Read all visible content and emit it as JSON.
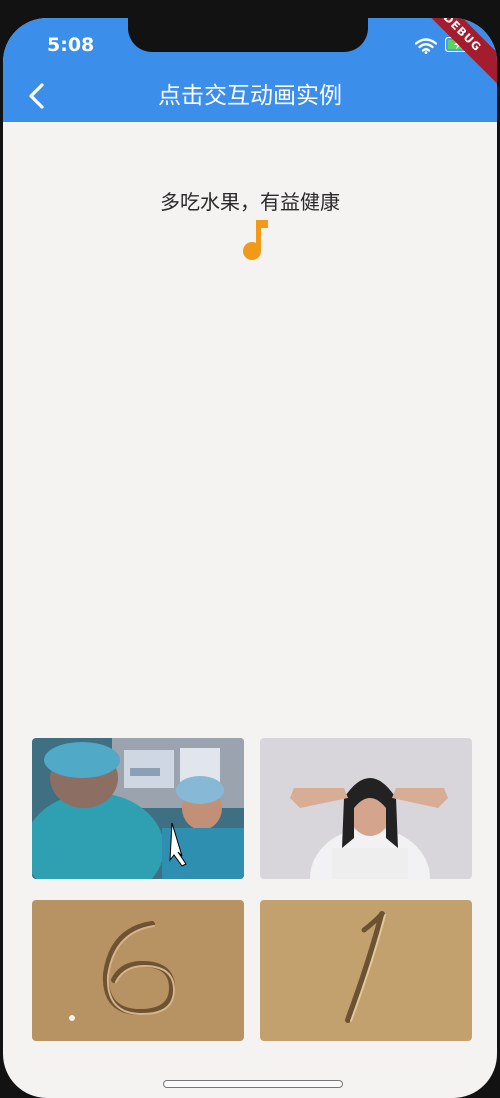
{
  "status_bar": {
    "time": "5:08"
  },
  "debug_banner": {
    "label": "DEBUG"
  },
  "app_bar": {
    "title": "点击交互动画实例",
    "back_icon": "chevron-left-icon",
    "background": "#3b8ee9"
  },
  "content": {
    "message": "多吃水果，有益健康",
    "icon": "music-note-icon",
    "icon_color": "#f19a1a"
  },
  "gallery": {
    "images": [
      {
        "name": "surgeons-xray-photo"
      },
      {
        "name": "girl-hands-behind-head-photo"
      },
      {
        "name": "sand-number-six-photo"
      },
      {
        "name": "sand-number-one-photo"
      }
    ]
  }
}
